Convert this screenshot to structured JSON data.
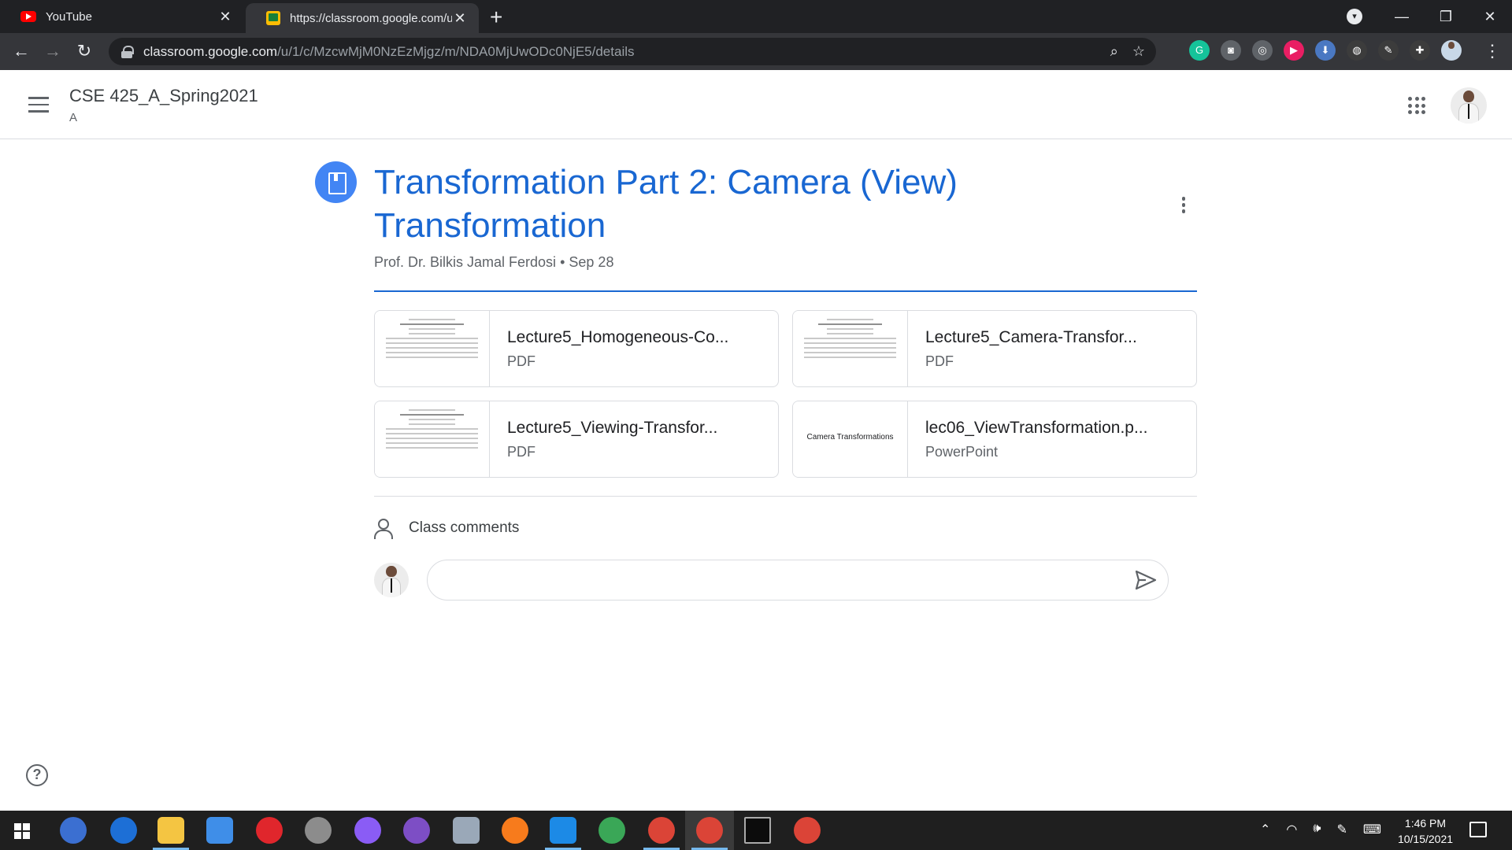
{
  "browser": {
    "tabs": [
      {
        "title": "YouTube",
        "active": false,
        "icon": "youtube-icon"
      },
      {
        "title": "https://classroom.google.com/u/",
        "active": true,
        "icon": "classroom-icon"
      }
    ],
    "url_host": "classroom.google.com",
    "url_path": "/u/1/c/MzcwMjM0NzEzMjgz/m/NDA0MjUwODc0NjE5/details"
  },
  "header": {
    "course_title": "CSE 425_A_Spring2021",
    "course_section": "A"
  },
  "material": {
    "title": "Transformation Part 2: Camera (View) Transformation",
    "author": "Prof. Dr. Bilkis Jamal Ferdosi",
    "separator": "•",
    "date": "Sep 28",
    "attachments": [
      {
        "name": "Lecture5_Homogeneous-Co...",
        "type": "PDF",
        "thumb_text": ""
      },
      {
        "name": "Lecture5_Camera-Transfor...",
        "type": "PDF",
        "thumb_text": ""
      },
      {
        "name": "Lecture5_Viewing-Transfor...",
        "type": "PDF",
        "thumb_text": ""
      },
      {
        "name": "lec06_ViewTransformation.p...",
        "type": "PowerPoint",
        "thumb_text": "Camera Transformations"
      }
    ]
  },
  "comments": {
    "label": "Class comments",
    "input_value": ""
  },
  "help": {
    "glyph": "?"
  },
  "taskbar": {
    "time": "1:46 PM",
    "date": "10/15/2021"
  },
  "colors": {
    "accent_blue": "#1967d2",
    "icon_blue": "#4285f4",
    "chrome_dark": "#202124",
    "chrome_toolbar": "#35363a"
  }
}
